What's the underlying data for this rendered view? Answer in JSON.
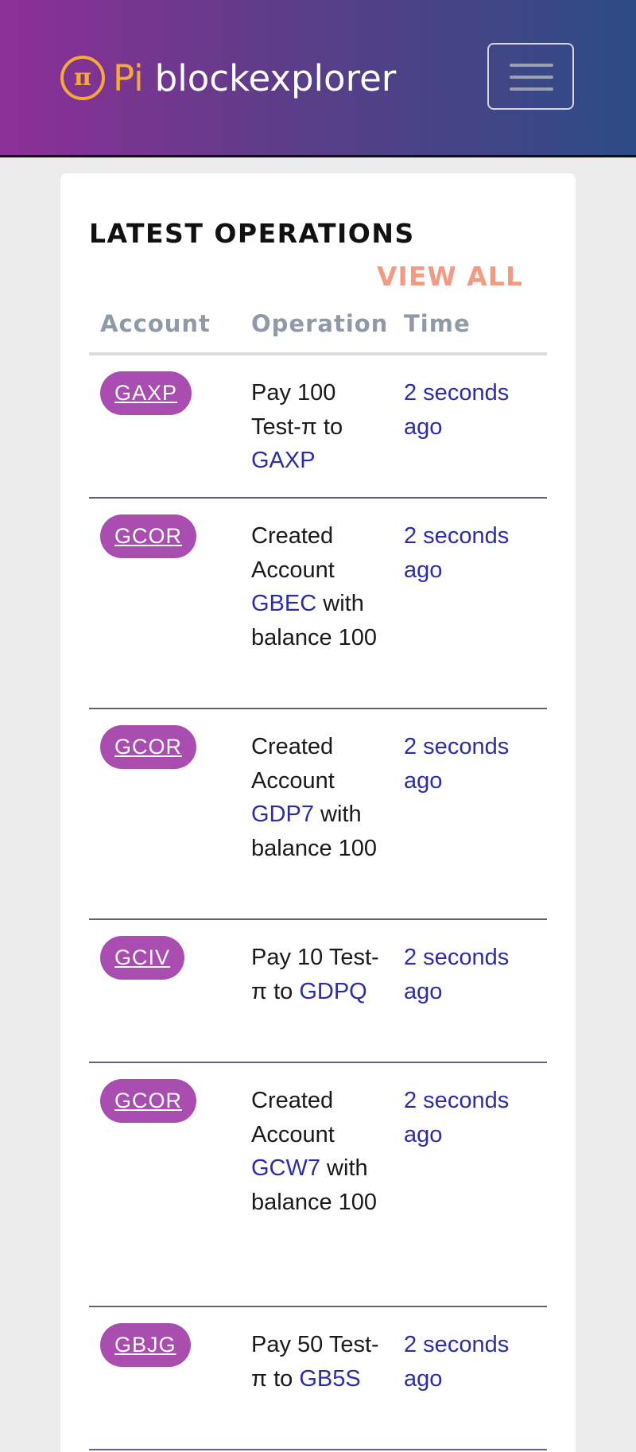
{
  "header": {
    "logo_symbol": "π",
    "logo_pi": "Pi",
    "logo_text": "blockexplorer"
  },
  "card": {
    "title": "LATEST OPERATIONS",
    "view_all": "VIEW ALL",
    "columns": [
      "Account",
      "Operation",
      "Time"
    ]
  },
  "rows": [
    {
      "account": "GAXP",
      "op_prefix": "Pay 100 Test-π to ",
      "op_link": "GAXP",
      "op_suffix": "",
      "time": "2 seconds ago"
    },
    {
      "account": "GCOR",
      "op_prefix": "Created Account ",
      "op_link": "GBEC",
      "op_suffix": " with balance 100",
      "time": "2 seconds ago"
    },
    {
      "account": "GCOR",
      "op_prefix": "Created Account ",
      "op_link": "GDP7",
      "op_suffix": " with balance 100",
      "time": "2 seconds ago"
    },
    {
      "account": "GCIV",
      "op_prefix": "Pay 10 Test-π to ",
      "op_link": "GDPQ",
      "op_suffix": "",
      "time": "2 seconds ago"
    },
    {
      "account": "GCOR",
      "op_prefix": "Created Account ",
      "op_link": "GCW7",
      "op_suffix": " with balance 100",
      "time": "2 seconds ago"
    },
    {
      "account": "GBJG",
      "op_prefix": "Pay 50 Test-π to ",
      "op_link": "GB5S",
      "op_suffix": "",
      "time": "2 seconds ago"
    }
  ],
  "colors": {
    "badge": "#a94db0",
    "link": "#2d2da8",
    "view_all": "#f19a84",
    "logo_accent": "#f4a93a"
  }
}
